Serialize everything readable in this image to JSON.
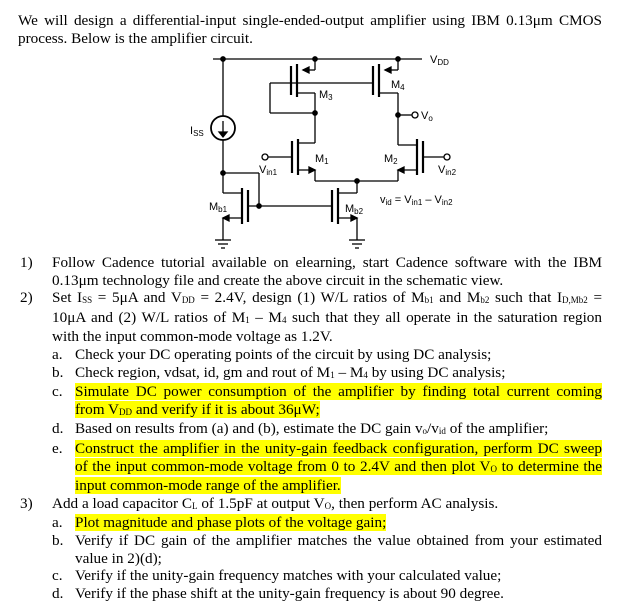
{
  "intro": [
    [
      "We will design a differential-input single-ended-output amplifier using IBM 0.13μm CMOS process. Below is the amplifier circuit."
    ]
  ],
  "circuit": {
    "vdd": "V",
    "vdd_sub": "DD",
    "iss": "I",
    "iss_sub": "SS",
    "m3": "M",
    "m3_sub": "3",
    "m4": "M",
    "m4_sub": "4",
    "vo": "V",
    "vo_sub": "o",
    "m1": "M",
    "m1_sub": "1",
    "m2": "M",
    "m2_sub": "2",
    "vin1": "V",
    "vin1_sub": "in1",
    "vin2": "V",
    "vin2_sub": "in2",
    "mb1": "M",
    "mb1_sub": "b1",
    "mb2": "M",
    "mb2_sub": "b2",
    "vid": "v",
    "vid_sub": "id",
    "vid_eq": " = V",
    "vid_in1": "in1",
    "vid_minus": " – V",
    "vid_in2": "in2"
  },
  "items": [
    {
      "num": "1)",
      "segs": [
        [
          "Follow Cadence tutorial available on elearning, start Cadence software with the IBM 0.13μm technology file and create the above circuit in the schematic view."
        ]
      ]
    },
    {
      "num": "2)",
      "segs": [
        [
          "Set I"
        ],
        [
          "SS",
          1
        ],
        [
          " = 5μA and V"
        ],
        [
          "DD",
          1
        ],
        [
          " = 2.4V, design (1) W/L ratios of M"
        ],
        [
          "b1",
          1
        ],
        [
          " and M"
        ],
        [
          "b2",
          1
        ],
        [
          " such that I"
        ],
        [
          "D,Mb2",
          1
        ],
        [
          " = 10μA and (2) W/L ratios of M"
        ],
        [
          "1",
          1
        ],
        [
          " – M"
        ],
        [
          "4",
          1
        ],
        [
          " such that they all operate in the saturation region with the input common-mode voltage as 1.2V."
        ]
      ],
      "subs": [
        {
          "num": "a.",
          "hl": false,
          "segs": [
            [
              "Check your DC operating points of the circuit by using DC analysis;"
            ]
          ]
        },
        {
          "num": "b.",
          "hl": false,
          "segs": [
            [
              "Check region, vdsat, id, gm and rout of M"
            ],
            [
              "1",
              1
            ],
            [
              " – M"
            ],
            [
              "4",
              1
            ],
            [
              " by using DC analysis;"
            ]
          ]
        },
        {
          "num": "c.",
          "hl": true,
          "segs": [
            [
              "Simulate DC power consumption of the amplifier by finding total current coming from V"
            ],
            [
              "DD",
              1
            ],
            [
              " and verify if it is about 36μW;"
            ]
          ]
        },
        {
          "num": "d.",
          "hl": false,
          "segs": [
            [
              "Based on results from (a) and (b), estimate the DC gain v"
            ],
            [
              "o",
              1
            ],
            [
              "/v"
            ],
            [
              "id",
              1
            ],
            [
              " of the amplifier;"
            ]
          ]
        },
        {
          "num": "e.",
          "hl": true,
          "segs": [
            [
              "Construct the amplifier in the unity-gain feedback configuration, perform DC sweep of the input common-mode voltage from 0 to 2.4V and then plot V"
            ],
            [
              "O",
              1
            ],
            [
              " to determine the input common-mode range of the amplifier."
            ]
          ]
        }
      ]
    },
    {
      "num": "3)",
      "segs": [
        [
          "Add a load capacitor C"
        ],
        [
          "L",
          1
        ],
        [
          " of 1.5pF at output V"
        ],
        [
          "O",
          1
        ],
        [
          ", then perform AC analysis."
        ]
      ],
      "subs": [
        {
          "num": "a.",
          "hl": true,
          "segs": [
            [
              "Plot magnitude and phase plots of the voltage gain;"
            ]
          ]
        },
        {
          "num": "b.",
          "hl": false,
          "segs": [
            [
              "Verify if DC gain of the amplifier matches the value obtained from your estimated value in 2)(d);"
            ]
          ]
        },
        {
          "num": "c.",
          "hl": false,
          "segs": [
            [
              "Verify if the unity-gain frequency matches with your calculated value;"
            ]
          ]
        },
        {
          "num": "d.",
          "hl": false,
          "segs": [
            [
              "Verify if the phase shift at the unity-gain frequency is about 90 degree."
            ]
          ]
        }
      ]
    }
  ],
  "colors": {
    "highlight": "#ffff00"
  }
}
